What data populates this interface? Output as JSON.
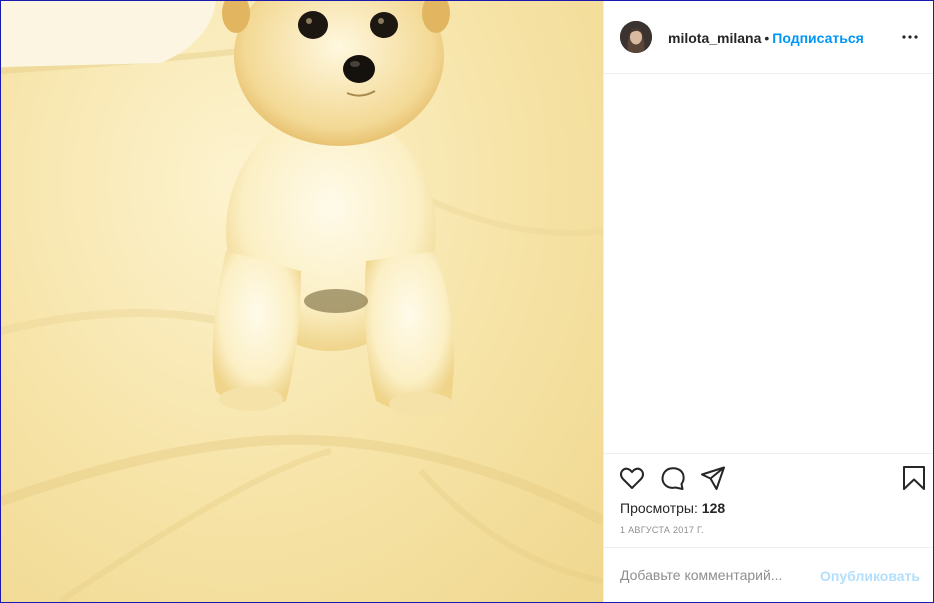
{
  "post": {
    "media_description": "small fluffy yorkshire terrier puppy sitting on a cream bed sheet",
    "header": {
      "username": "milota_milana",
      "separator": "•",
      "follow_label": "Подписаться",
      "more_icon": "more-horizontal-icon"
    },
    "actions": {
      "like_icon": "heart-icon",
      "comment_icon": "comment-icon",
      "share_icon": "share-icon",
      "save_icon": "bookmark-icon"
    },
    "views_label": "Просмотры:",
    "views_count": "128",
    "date": "1 АВГУСТА 2017 Г.",
    "comment": {
      "placeholder": "Добавьте комментарий...",
      "publish_label": "Опубликовать"
    }
  },
  "colors": {
    "link": "#0095f6",
    "publish_disabled": "#b3dffc",
    "border": "#efefef",
    "text": "#262626",
    "muted": "#8e8e8e"
  }
}
